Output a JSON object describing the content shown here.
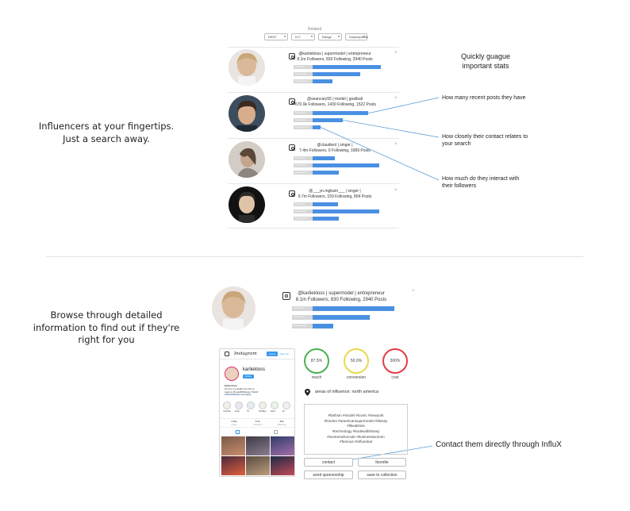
{
  "left_headline_1": [
    "Influencers at your fingertips.",
    "Just a search away."
  ],
  "left_headline_2": [
    "Browse through detailed",
    "information to find out if they're",
    "right for you"
  ],
  "filters": {
    "title": "Related",
    "options": [
      "REDT",
      "ICY",
      "Range",
      "Subscriptions"
    ]
  },
  "results": [
    {
      "bio": "@karliekloss | supermodel | entrepreneur",
      "stats": "8.1m Followers, 830 Following, 2940 Posts",
      "bars": [
        0.86,
        0.6,
        0.25
      ]
    },
    {
      "bio": "@seancary55 | model | goalball",
      "stats": "670.9k Followers, 1430 Following, 1522 Posts",
      "bars": [
        0.7,
        0.38,
        0.1
      ]
    },
    {
      "bio": "@claudieol | singer |",
      "stats": "7.4m Followers, 0 Following, 1689 Posts",
      "bars": [
        0.28,
        0.84,
        0.33
      ]
    },
    {
      "bio": "@___yn.mgbam___ | singer |",
      "stats": "9.7m Followers, 159 Following, 804 Posts",
      "bars": [
        0.32,
        0.84,
        0.33
      ]
    }
  ],
  "stat_labels": [
    "Followers",
    "Relevance",
    "Engagement"
  ],
  "annotations": {
    "quick_stats": [
      "Quickly guague",
      "important stats"
    ],
    "recent_posts": "How many recent posts they have",
    "relates": [
      "How closely their contact relates to",
      "your search"
    ],
    "interact": [
      "How much do they interact with",
      "their followers"
    ],
    "contact": "Contact them directly through InfluX"
  },
  "detail": {
    "bio": "@karliekloss | supermodel | entrepreneur",
    "stats": "8.1m Followers, 830 Following, 2940 Posts",
    "bars": [
      0.86,
      0.6,
      0.22
    ],
    "gauges": [
      {
        "value": "87.5%",
        "label": "reach",
        "color": "#4caf50"
      },
      {
        "value": "50.0%",
        "label": "conversion",
        "color": "#e8d84b"
      },
      {
        "value": "300%",
        "label": "cost",
        "color": "#e53945"
      }
    ],
    "areas_label": "areas of influence: north america",
    "hashtags": [
      "#fashion #model #iconic #newyork",
      "#london #americansupermodel #klossy",
      "#likeakloss",
      "#technology #kodewithklossy",
      "#womenwhocode #businesswomen",
      "#famous #influential"
    ],
    "buttons": {
      "contact": "contact",
      "favorite": "favorite",
      "send_sponsorship": "send sponsorship",
      "save_collection": "save to collection"
    }
  },
  "instagram": {
    "brand": "Instagram",
    "login": "Log In",
    "signup": "Sign Up",
    "username": "karliekloss",
    "follow": "Follow",
    "name": "Karlie Kloss",
    "bio_lines": [
      "Go love me giraffe from Dis.ny",
      "Apply to #KodeWithKlossy TODAY",
      "www.karliekloss.com/apply"
    ],
    "highlights": [
      "YouTube",
      "Kode",
      "TV",
      "Holidays",
      "Paris",
      "W"
    ],
    "counts": [
      {
        "value": "2,944",
        "label": "posts"
      },
      {
        "value": "8.1m",
        "label": "followers"
      },
      {
        "value": "833",
        "label": "following"
      }
    ]
  }
}
